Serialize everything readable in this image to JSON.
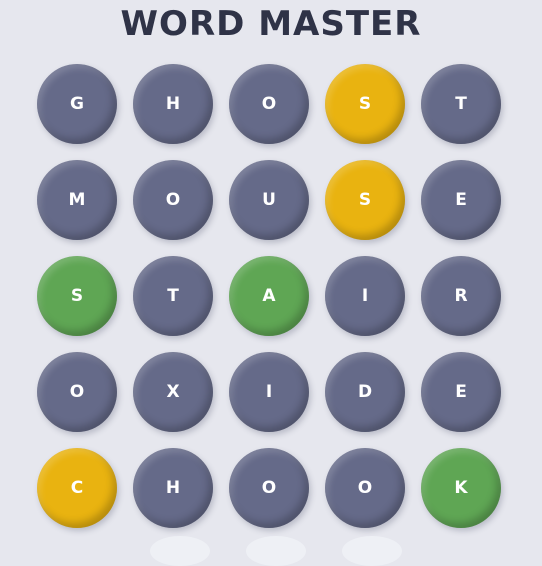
{
  "title": "WORD MASTER",
  "colors": {
    "background": "#e6e7ee",
    "absent": "#656a89",
    "present": "#e9b310",
    "correct": "#5fa654"
  },
  "board": {
    "rows": [
      {
        "tiles": [
          {
            "letter": "G",
            "state": "absent"
          },
          {
            "letter": "H",
            "state": "absent"
          },
          {
            "letter": "O",
            "state": "absent"
          },
          {
            "letter": "S",
            "state": "present"
          },
          {
            "letter": "T",
            "state": "absent"
          }
        ]
      },
      {
        "tiles": [
          {
            "letter": "M",
            "state": "absent"
          },
          {
            "letter": "O",
            "state": "absent"
          },
          {
            "letter": "U",
            "state": "absent"
          },
          {
            "letter": "S",
            "state": "present"
          },
          {
            "letter": "E",
            "state": "absent"
          }
        ]
      },
      {
        "tiles": [
          {
            "letter": "S",
            "state": "correct"
          },
          {
            "letter": "T",
            "state": "absent"
          },
          {
            "letter": "A",
            "state": "correct"
          },
          {
            "letter": "I",
            "state": "absent"
          },
          {
            "letter": "R",
            "state": "absent"
          }
        ]
      },
      {
        "tiles": [
          {
            "letter": "O",
            "state": "absent"
          },
          {
            "letter": "X",
            "state": "absent"
          },
          {
            "letter": "I",
            "state": "absent"
          },
          {
            "letter": "D",
            "state": "absent"
          },
          {
            "letter": "E",
            "state": "absent"
          }
        ]
      },
      {
        "tiles": [
          {
            "letter": "C",
            "state": "present"
          },
          {
            "letter": "H",
            "state": "absent"
          },
          {
            "letter": "O",
            "state": "absent"
          },
          {
            "letter": "O",
            "state": "absent"
          },
          {
            "letter": "K",
            "state": "correct"
          }
        ]
      }
    ]
  }
}
